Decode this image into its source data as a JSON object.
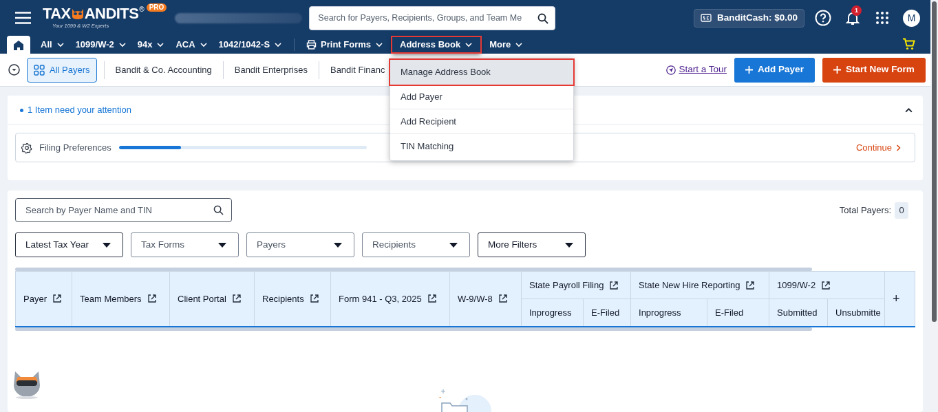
{
  "header": {
    "logo_left": "TAX",
    "logo_right": "ANDITS",
    "registered": "®",
    "badge": "PRO",
    "tagline": "Your 1099 & W2 Experts",
    "search": {
      "placeholder": "Search for Payers, Recipients, Groups, and Team Me"
    },
    "bandit_cash": "BanditCash: $0.00",
    "notifications": "1",
    "avatar": "M"
  },
  "nav": {
    "items": [
      {
        "kind": "home",
        "selected": true
      },
      {
        "kind": "dropdown",
        "label": "All",
        "selected": false
      },
      {
        "kind": "dropdown",
        "label": "1099/W-2",
        "selected": false
      },
      {
        "kind": "dropdown",
        "label": "94x",
        "selected": false
      },
      {
        "kind": "dropdown",
        "label": "ACA",
        "selected": false
      },
      {
        "kind": "dropdown",
        "label": "1042/1042-S",
        "selected": false
      },
      {
        "kind": "print",
        "label": "Print Forms",
        "selected": false
      },
      {
        "kind": "dropdown",
        "label": "Address Book",
        "selected": false,
        "highlighted": true,
        "expanded": true,
        "menu": [
          {
            "label": "Manage Address Book",
            "highlighted": true
          },
          {
            "label": "Add Payer",
            "highlighted": false
          },
          {
            "label": "Add Recipient",
            "highlighted": false
          },
          {
            "label": "TIN Matching",
            "highlighted": false
          }
        ]
      },
      {
        "kind": "dropdown",
        "label": "More",
        "selected": false
      }
    ]
  },
  "toolbar": {
    "payers": [
      {
        "label": "All Payers",
        "selected": true
      },
      {
        "label": "Bandit & Co. Accounting",
        "selected": false
      },
      {
        "label": "Bandit Enterprises",
        "selected": false
      },
      {
        "label": "Bandit Financ",
        "selected": false
      }
    ],
    "tour_link": "Start a Tour",
    "buttons": [
      {
        "label": "Add Payer",
        "kind": "primary"
      },
      {
        "label": "Start New Form",
        "kind": "accent"
      }
    ]
  },
  "attention": {
    "message": "1 Item need your attention",
    "expanded": true,
    "task": {
      "label": "Filing Preferences",
      "level": 0.25,
      "action": "Continue"
    }
  },
  "payers_panel": {
    "search": {
      "placeholder": "Search by Payer Name and TIN"
    },
    "total_label": "Total Payers:",
    "total": "0",
    "filters": [
      {
        "label": "Latest Tax Year",
        "placeholder": false
      },
      {
        "label": "Tax Forms",
        "placeholder": true
      },
      {
        "label": "Payers",
        "placeholder": true
      },
      {
        "label": "Recipients",
        "placeholder": true
      },
      {
        "label": "More Filters",
        "placeholder": false
      }
    ],
    "table": {
      "columns": [
        {
          "label": "Payer"
        },
        {
          "label": "Team Members"
        },
        {
          "label": "Client Portal"
        },
        {
          "label": "Recipients"
        },
        {
          "label": "Form 941 - Q3, 2025"
        },
        {
          "label": "W-9/W-8"
        },
        {
          "label": "State Payroll Filing",
          "children": [
            {
              "label": "Inprogress"
            },
            {
              "label": "E-Filed"
            }
          ]
        },
        {
          "label": "State New Hire Reporting",
          "children": [
            {
              "label": "Inprogress"
            },
            {
              "label": "E-Filed"
            }
          ]
        },
        {
          "label": "1099/W-2",
          "children": [
            {
              "label": "Submitted"
            },
            {
              "label": "Unsubmitte"
            }
          ]
        }
      ],
      "add_column": "+"
    }
  }
}
